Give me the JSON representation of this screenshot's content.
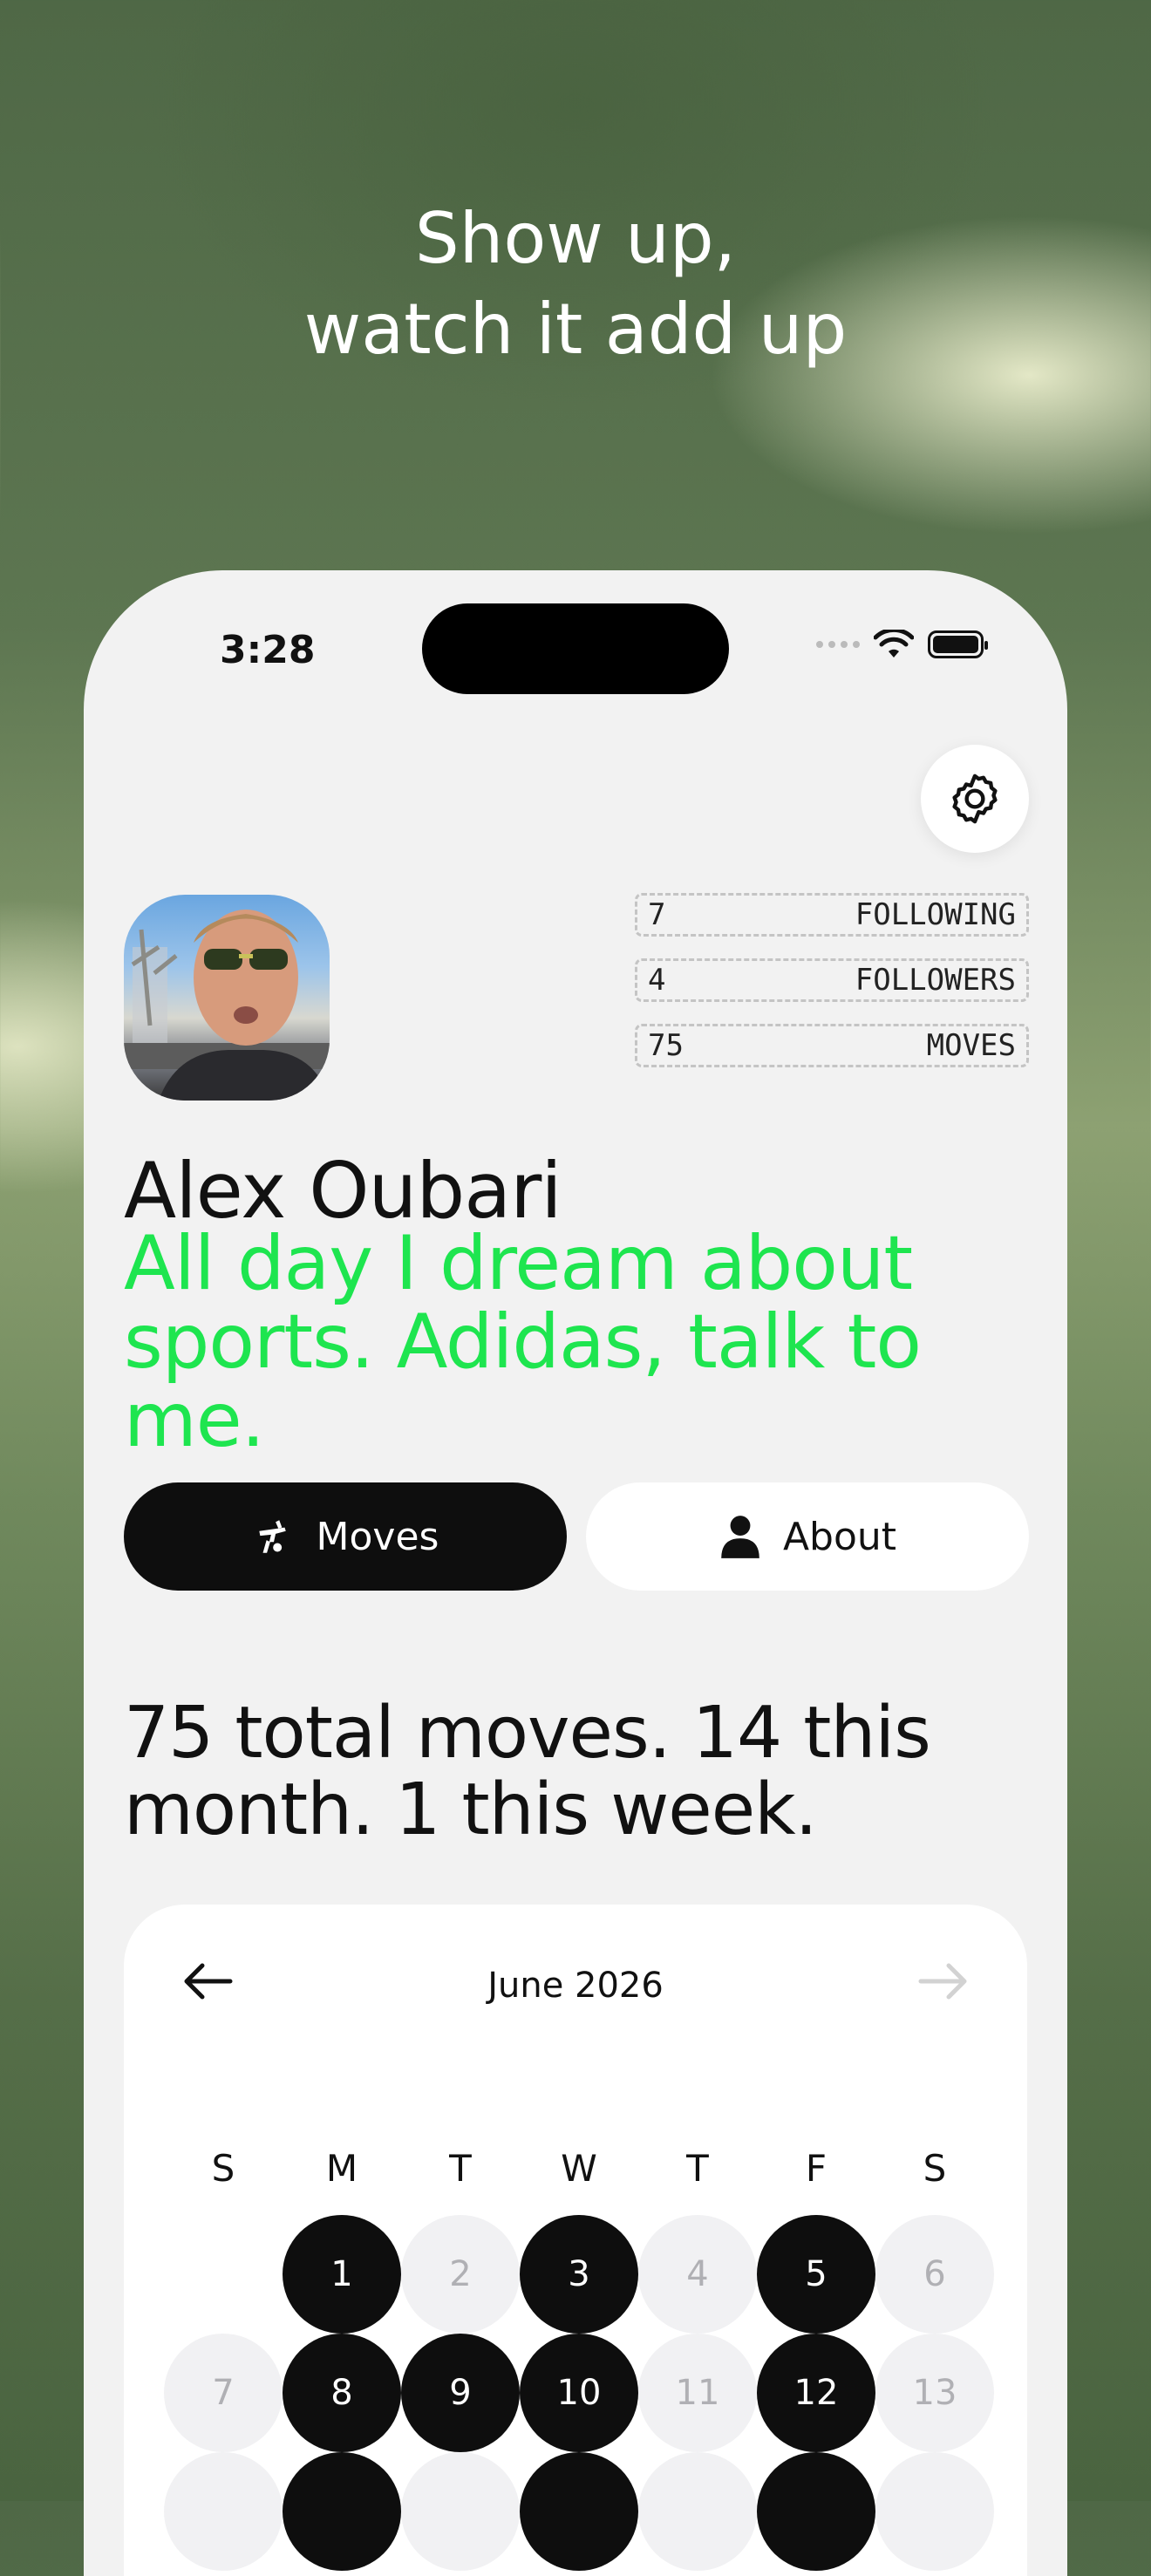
{
  "headline": {
    "line1": "Show up,",
    "line2": "watch it add up"
  },
  "status_bar": {
    "time": "3:28"
  },
  "profile": {
    "name": "Alex Oubari",
    "bio": "All day I dream about sports. Adidas, talk to me.",
    "stats": [
      {
        "value": "7",
        "label": "FOLLOWING"
      },
      {
        "value": "4",
        "label": "FOLLOWERS"
      },
      {
        "value": "75",
        "label": "MOVES"
      }
    ]
  },
  "tabs": {
    "moves": "Moves",
    "about": "About",
    "selected": "Moves"
  },
  "summary": "75 total moves. 14 this month. 1 this week.",
  "calendar": {
    "title": "June 2026",
    "weekdays": [
      "S",
      "M",
      "T",
      "W",
      "T",
      "F",
      "S"
    ],
    "row1": [
      "",
      "1",
      "2",
      "3",
      "4",
      "5",
      "6"
    ],
    "row2": [
      "7",
      "8",
      "9",
      "10",
      "11",
      "12",
      "13"
    ],
    "active_days": [
      "1",
      "3",
      "5",
      "8",
      "9",
      "10",
      "12"
    ]
  },
  "colors": {
    "accent": "#1ee54f",
    "active_day": "#0e0e0e",
    "inactive_day": "#f1f1f3",
    "screen_bg": "#f2f2f2"
  },
  "icons": {
    "settings": "gear-icon",
    "moves_tab": "move-figure-icon",
    "about_tab": "person-icon",
    "prev": "arrow-left-icon",
    "next": "arrow-right-icon"
  }
}
